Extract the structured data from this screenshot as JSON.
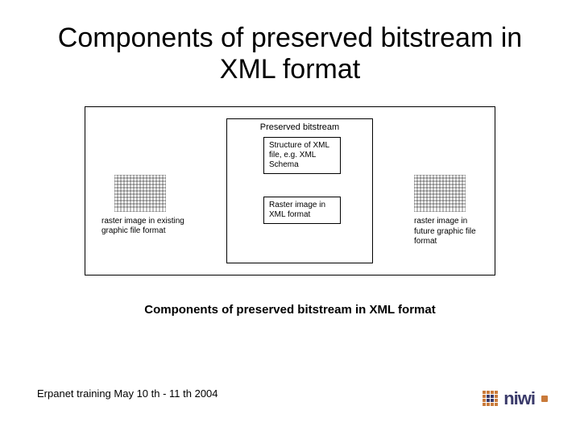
{
  "title": "Components of preserved bitstream in XML format",
  "diagram": {
    "inner_title": "Preserved bitstream",
    "structure_box": "Structure of XML file, e.g. XML Schema",
    "raster_xml_box": "Raster image in XML format",
    "left_caption": "raster image in existing graphic file format",
    "right_caption": "raster image in future graphic file format"
  },
  "subtitle": "Components of preserved bitstream in XML format",
  "footer": "Erpanet training May 10 th - 11 th 2004",
  "logo_text": "niwi"
}
